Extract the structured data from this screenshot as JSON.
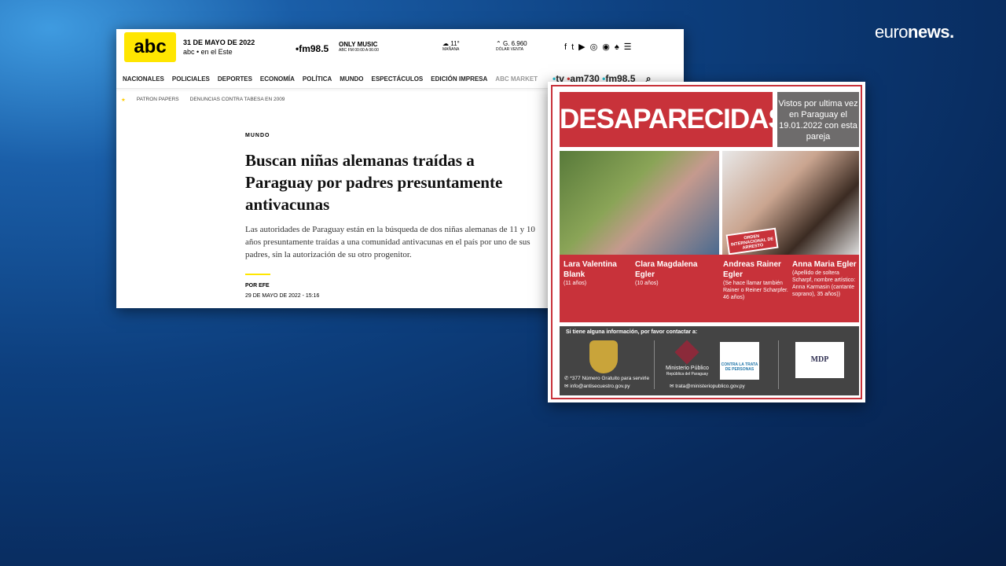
{
  "broadcaster": {
    "logo_light": "euro",
    "logo_bold": "news."
  },
  "site": {
    "logo": "abc",
    "date": "31 DE MAYO DE 2022",
    "subbrand": "abc • en el Este",
    "radio": "•fm98.5",
    "radio_show": "ONLY MUSIC",
    "radio_time": "ABC FM 00:00 A 06:00",
    "weather_temp": "11°",
    "weather_label": "MAÑANA",
    "dollar_value": "G. 6.960",
    "dollar_label": "DÓLAR VENTA",
    "social_icons": [
      "facebook-icon",
      "twitter-icon",
      "youtube-icon",
      "instagram-icon"
    ],
    "nav": [
      "NACIONALES",
      "POLICIALES",
      "DEPORTES",
      "ECONOMÍA",
      "POLÍTICA",
      "MUNDO",
      "ESPECTÁCULOS",
      "EDICIÓN IMPRESA",
      "ABC MARKET"
    ],
    "stations": {
      "tv": "tv",
      "am": "am730",
      "fm": "fm98.5"
    },
    "crumbs": [
      "PATRON PAPERS",
      "DENUNCIAS CONTRA TABESA EN 2009"
    ],
    "article": {
      "section": "MUNDO",
      "title": "Buscan niñas alemanas traídas a Paraguay por padres presuntamente antivacunas",
      "lede": "Las autoridades de Paraguay están en la búsqueda de dos niñas alemanas de 11 y 10 años presuntamente traídas a una comunidad antivacunas en el país por uno de sus padres, sin la autorización de su otro progenitor.",
      "byline": "POR EFE",
      "date": "29 DE MAYO DE 2022 - 15:16"
    }
  },
  "poster": {
    "headline": "DESAPARECIDAS",
    "seen": "Vistos por ultima vez en Paraguay el 19.01.2022 con esta pareja",
    "stamp": "ORDEN INTERNACIONAL DE ARRESTO",
    "people": [
      {
        "name": "Lara Valentina Blank",
        "note": "(11 años)"
      },
      {
        "name": "Clara Magdalena Egler",
        "note": "(10 años)"
      },
      {
        "name": "Andreas Rainer Egler",
        "note": "(Se hace llamar también Rainer o Reiner Scharpfer. 46 años)"
      },
      {
        "name": "Anna Maria Egler",
        "note": "(Apellido de soltera Scharpf, nombre artístico: Anna Karmasin (cantante soprano), 35 años))"
      }
    ],
    "contact_intro": "Si tiene alguna información, por favor contactar a:",
    "phone": "*377 Número Gratuito para servirle",
    "email1": "info@antisecuestro.gov.py",
    "ministry": "Ministerio Público",
    "ministry_sub": "República del Paraguay",
    "trata_logo": "CONTRA LA TRATA DE PERSONAS",
    "email2": "trata@ministeriopublico.gov.py",
    "mdp": "MDP"
  }
}
